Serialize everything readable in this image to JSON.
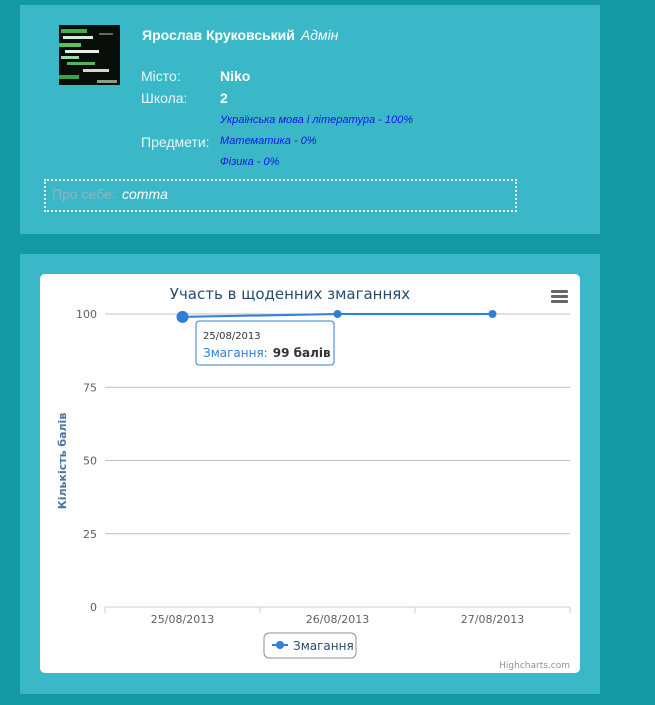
{
  "profile": {
    "name": "Ярослав Круковський",
    "role": "Адмін",
    "avatar_icon": "code-screen-image",
    "city_label": "Місто:",
    "city_value": "Niko",
    "school_label": "Школа:",
    "school_value": "2",
    "subjects_label": "Предмети:",
    "subjects": [
      "Українська мова і література - 100%",
      "Математика - 0%",
      "Фізика - 0%"
    ],
    "about_label": "Про себе:",
    "about_value": "comma"
  },
  "chart": {
    "menu_icon": "hamburger-menu-icon",
    "credits": "Highcharts.com",
    "tooltip": {
      "date": "25/08/2013",
      "series_label": "Змагання:",
      "value_text": "99 балів"
    }
  },
  "chart_data": {
    "type": "line",
    "title": "Участь в щоденних змаганнях",
    "xlabel": "",
    "ylabel": "Кількість балів",
    "categories": [
      "25/08/2013",
      "26/08/2013",
      "27/08/2013"
    ],
    "series": [
      {
        "name": "Змагання",
        "values": [
          99,
          100,
          100
        ],
        "color": "#2f7ed8"
      }
    ],
    "ylim": [
      0,
      100
    ],
    "yticks": [
      0,
      25,
      50,
      75,
      100
    ],
    "grid": true,
    "legend": "bottom-center"
  },
  "colors": {
    "page_background": "#1299a2",
    "panel_background": "#3bb8c7",
    "subject_link": "#1414ee",
    "series": "#2f7ed8"
  }
}
